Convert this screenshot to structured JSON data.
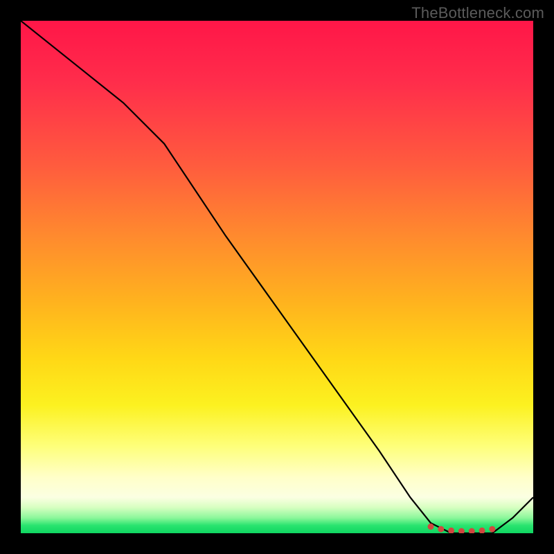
{
  "watermark": "TheBottleneck.com",
  "chart_data": {
    "type": "line",
    "title": "",
    "xlabel": "",
    "ylabel": "",
    "xlim": [
      0,
      100
    ],
    "ylim": [
      0,
      100
    ],
    "grid": false,
    "legend": false,
    "note": "Background is a vertical gradient: high bottleneck % (red) at top → 0 % (green) at bottom. Curve shows best-match zone dipping into green near x≈82–92.",
    "x": [
      0,
      10,
      20,
      28,
      40,
      50,
      60,
      70,
      76,
      80,
      84,
      88,
      92,
      96,
      100
    ],
    "y": [
      100,
      92,
      84,
      76,
      58,
      44,
      30,
      16,
      7,
      2,
      0,
      0,
      0,
      3,
      7
    ],
    "marker_x": [
      80,
      82,
      84,
      86,
      88,
      90,
      92
    ],
    "marker_y": [
      1.3,
      0.8,
      0.5,
      0.4,
      0.4,
      0.5,
      0.8
    ]
  }
}
